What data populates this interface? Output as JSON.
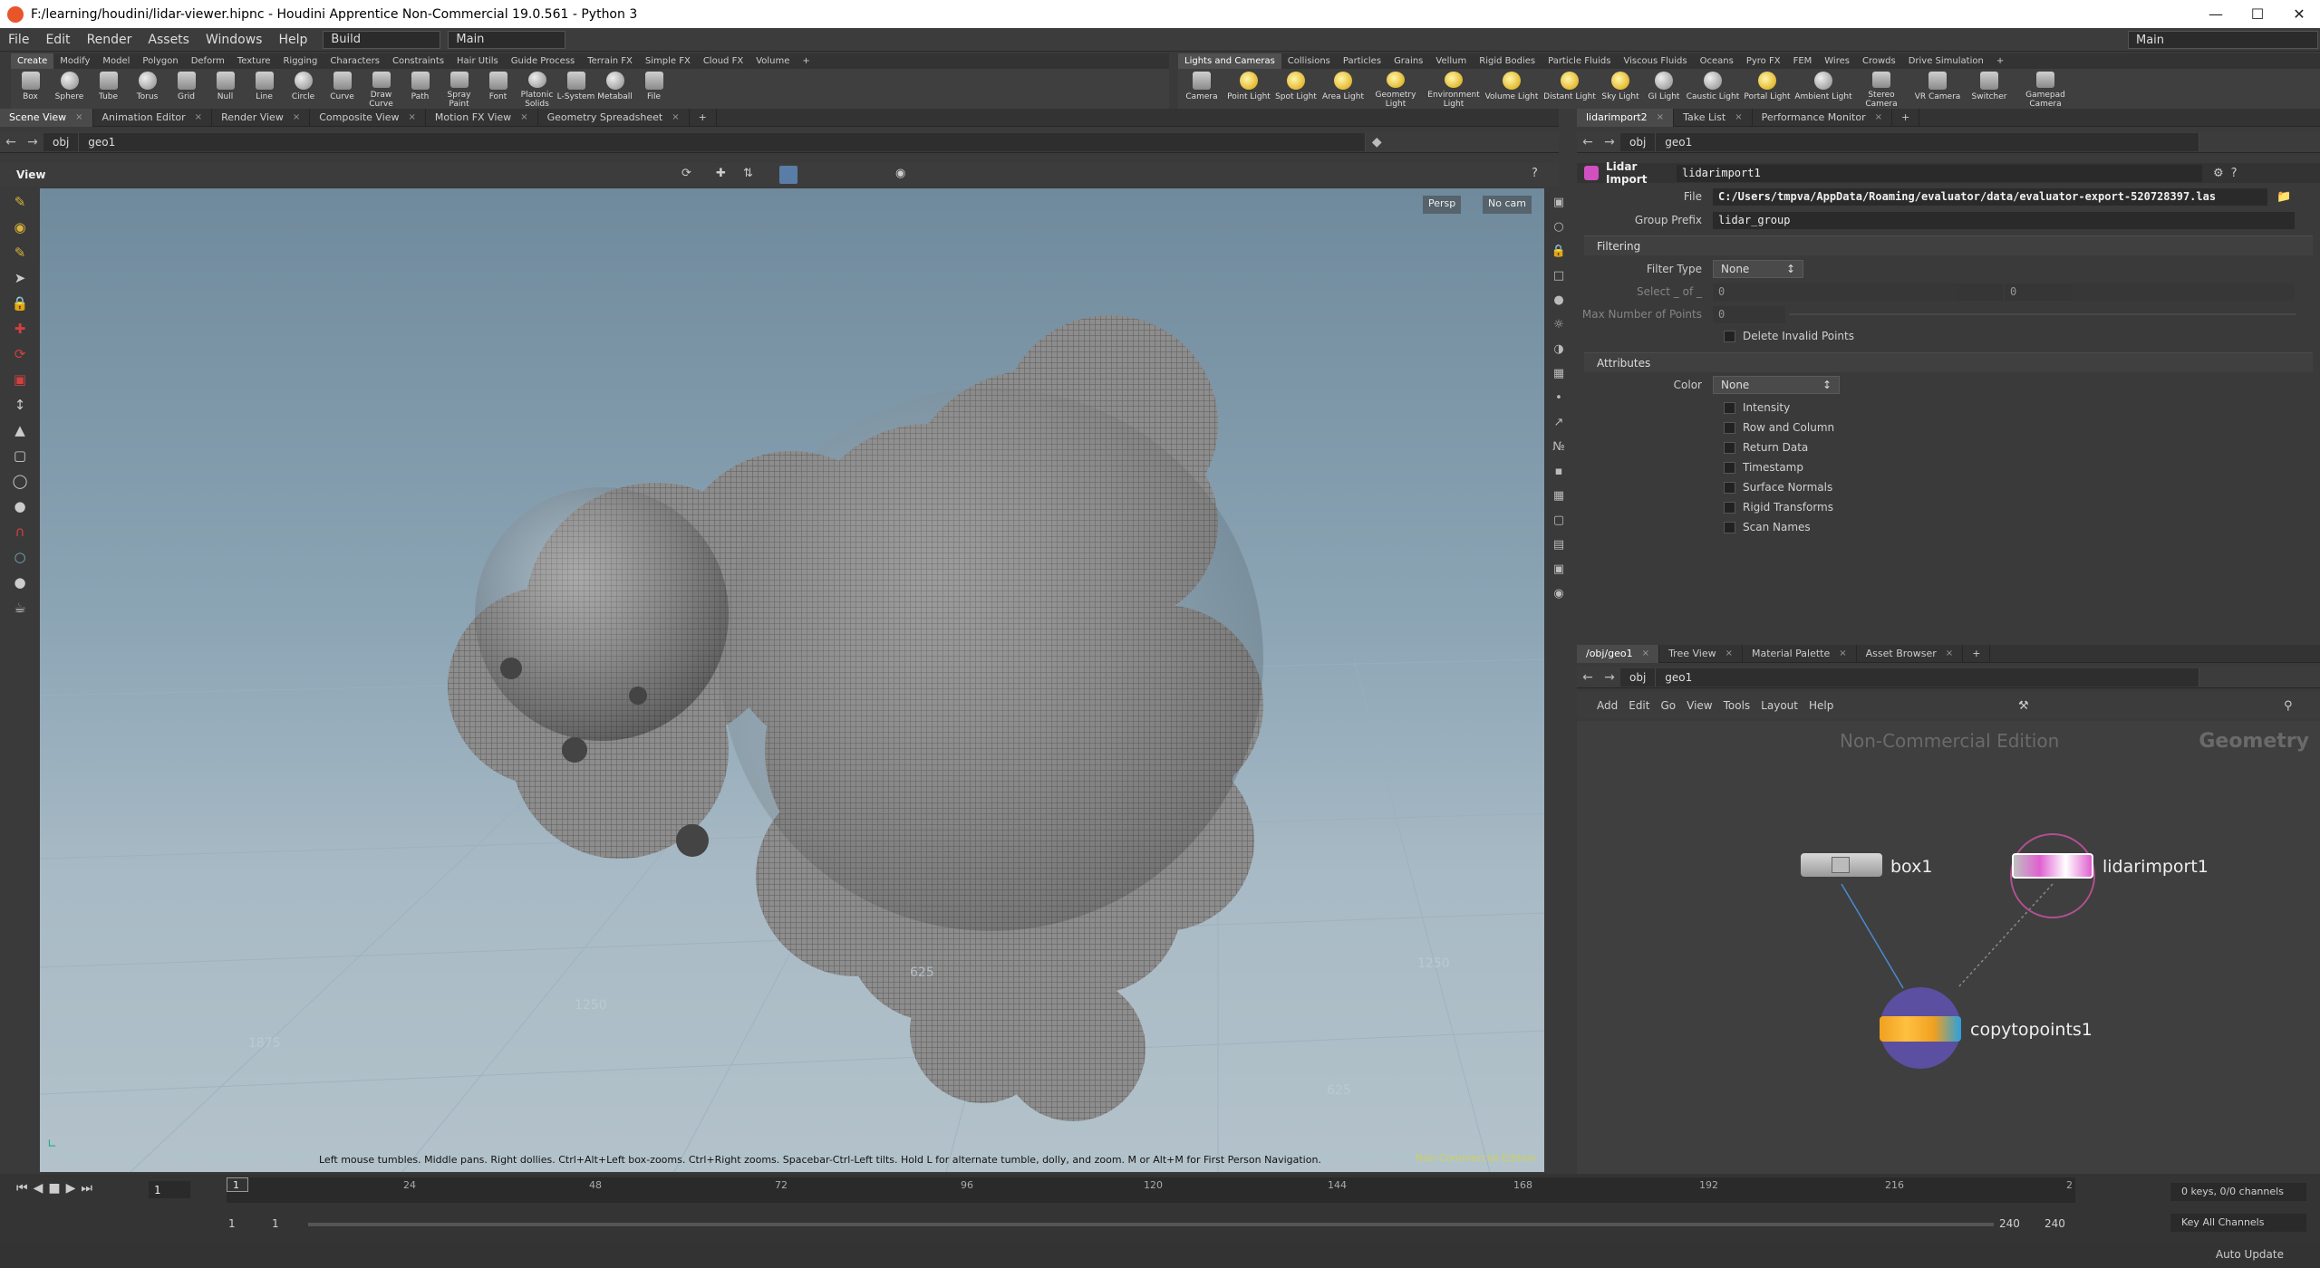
{
  "titlebar": {
    "title": "F:/learning/houdini/lidar-viewer.hipnc - Houdini Apprentice Non-Commercial 19.0.561 - Python 3"
  },
  "menu": {
    "items": [
      "File",
      "Edit",
      "Render",
      "Assets",
      "Windows",
      "Help"
    ],
    "desktop": "Build",
    "main": "Main",
    "right_main": "Main"
  },
  "shelf_left": {
    "tabs": [
      "Create",
      "Modify",
      "Model",
      "Polygon",
      "Deform",
      "Texture",
      "Rigging",
      "Characters",
      "Constraints",
      "Hair Utils",
      "Guide Process",
      "Terrain FX",
      "Simple FX",
      "Cloud FX",
      "Volume"
    ],
    "tools": [
      "Box",
      "Sphere",
      "Tube",
      "Torus",
      "Grid",
      "Null",
      "Line",
      "Circle",
      "Curve",
      "Draw Curve",
      "Path",
      "Spray Paint",
      "Font",
      "Platonic Solids",
      "L-System",
      "Metaball",
      "File"
    ]
  },
  "shelf_right": {
    "tabs": [
      "Lights and Cameras",
      "Collisions",
      "Particles",
      "Grains",
      "Vellum",
      "Rigid Bodies",
      "Particle Fluids",
      "Viscous Fluids",
      "Oceans",
      "Pyro FX",
      "FEM",
      "Wires",
      "Crowds",
      "Drive Simulation"
    ],
    "tools": [
      "Camera",
      "Point Light",
      "Spot Light",
      "Area Light",
      "Geometry Light",
      "Environment Light",
      "Volume Light",
      "Distant Light",
      "Sky Light",
      "GI Light",
      "Caustic Light",
      "Portal Light",
      "Ambient Light",
      "Stereo Camera",
      "VR Camera",
      "Switcher",
      "Gamepad Camera"
    ]
  },
  "left_pane": {
    "tabs": [
      "Scene View",
      "Animation Editor",
      "Render View",
      "Composite View",
      "Motion FX View",
      "Geometry Spreadsheet"
    ],
    "path": [
      "obj",
      "geo1"
    ],
    "view_label": "View",
    "persp": "Persp",
    "cam": "No cam",
    "hint": "Left mouse tumbles. Middle pans. Right dollies. Ctrl+Alt+Left box-zooms. Ctrl+Right zooms. Spacebar-Ctrl-Left tilts. Hold L for alternate tumble, dolly, and zoom.    M or Alt+M for First Person Navigation.",
    "watermark": "Non-Commercial Edition",
    "grid_labels": [
      "1875",
      "1250",
      "625",
      "625",
      "1250"
    ]
  },
  "param_pane": {
    "tabs": [
      "lidarimport2",
      "Take List",
      "Performance Monitor"
    ],
    "path": [
      "obj",
      "geo1"
    ],
    "node_type": "Lidar Import",
    "node_name": "lidarimport1",
    "file_label": "File",
    "file_value": "C:/Users/tmpva/AppData/Roaming/evaluator/data/evaluator-export-520728397.las",
    "group_prefix_label": "Group Prefix",
    "group_prefix_value": "lidar_group",
    "filtering_label": "Filtering",
    "filter_type_label": "Filter Type",
    "filter_type_value": "None",
    "select_label": "Select _ of _",
    "select_a": "0",
    "select_b": "0",
    "max_points_label": "Max Number of Points",
    "max_points_value": "0",
    "delete_invalid_label": "Delete Invalid Points",
    "attributes_label": "Attributes",
    "color_label": "Color",
    "color_value": "None",
    "checks": [
      "Intensity",
      "Row and Column",
      "Return Data",
      "Timestamp",
      "Surface Normals",
      "Rigid Transforms",
      "Scan Names"
    ]
  },
  "net_pane": {
    "tabs": [
      "/obj/geo1",
      "Tree View",
      "Material Palette",
      "Asset Browser"
    ],
    "path": [
      "obj",
      "geo1"
    ],
    "menu": [
      "Add",
      "Edit",
      "Go",
      "View",
      "Tools",
      "Layout",
      "Help"
    ],
    "watermark": "Non-Commercial Edition",
    "context": "Geometry",
    "nodes": {
      "box": "box1",
      "lidar": "lidarimport1",
      "copy": "copytopoints1"
    }
  },
  "timeline": {
    "current_frame": "1",
    "ticks": [
      "24",
      "48",
      "72",
      "96",
      "120",
      "144",
      "168",
      "192",
      "216",
      "2"
    ],
    "marker": "1",
    "start": "1",
    "start2": "1",
    "end": "240",
    "end2": "240",
    "keys": "0 keys, 0/0 channels",
    "key_all": "Key All Channels",
    "auto_update": "Auto Update"
  },
  "colors": {
    "accent": "#d8b23a",
    "viewport_top": "#6f8a9c",
    "viewport_bottom": "#b3c2ca",
    "copy_node": "#f0a020",
    "lidar_node": "#d050c0"
  }
}
